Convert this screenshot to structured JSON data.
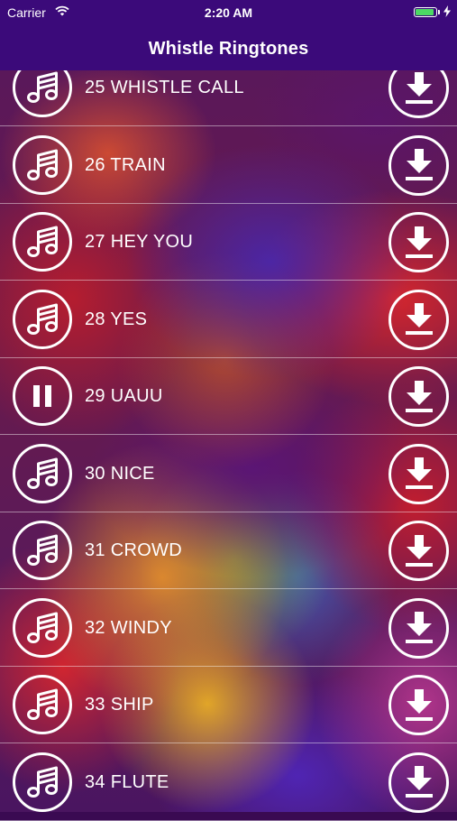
{
  "status_bar": {
    "carrier": "Carrier",
    "time": "2:20 AM",
    "battery_level": 1.0,
    "battery_color": "#4cd964"
  },
  "nav": {
    "title": "Whistle Ringtones"
  },
  "colors": {
    "bar_background": "#3b0a7a",
    "foreground": "#ffffff"
  },
  "ringtones": [
    {
      "label": "25 WHISTLE CALL",
      "state": "stopped",
      "icon": "music-note-icon"
    },
    {
      "label": "26 TRAIN",
      "state": "stopped",
      "icon": "music-note-icon"
    },
    {
      "label": "27 HEY YOU",
      "state": "stopped",
      "icon": "music-note-icon"
    },
    {
      "label": "28 YES",
      "state": "stopped",
      "icon": "music-note-icon"
    },
    {
      "label": "29 UAUU",
      "state": "playing",
      "icon": "pause-icon"
    },
    {
      "label": "30 NICE",
      "state": "stopped",
      "icon": "music-note-icon"
    },
    {
      "label": "31 CROWD",
      "state": "stopped",
      "icon": "music-note-icon"
    },
    {
      "label": "32 WINDY",
      "state": "stopped",
      "icon": "music-note-icon"
    },
    {
      "label": "33 SHIP",
      "state": "stopped",
      "icon": "music-note-icon"
    },
    {
      "label": "34 FLUTE",
      "state": "stopped",
      "icon": "music-note-icon"
    }
  ],
  "download_icon": "download-icon"
}
